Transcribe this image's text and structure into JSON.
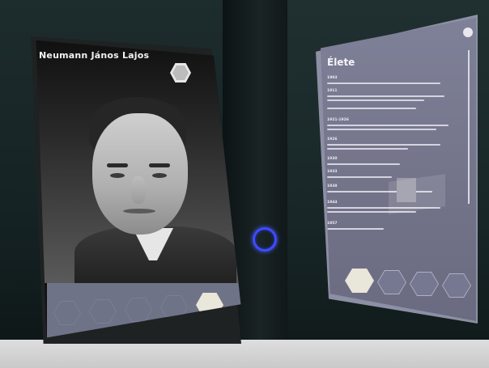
{
  "scene": {
    "description": "Museum exhibit with two vertical touchscreens and a blue ring sensor between them",
    "accent_ring_color": "#3c4cff"
  },
  "left_screen": {
    "person_name": "Neumann János Lajos",
    "logo_icon": "hex-seal-icon",
    "nav_hexagons": [
      {
        "label": "",
        "state": "outline"
      },
      {
        "label": "",
        "state": "outline"
      },
      {
        "label": "",
        "state": "outline"
      },
      {
        "label": "",
        "state": "outline"
      },
      {
        "label": "",
        "state": "active"
      }
    ]
  },
  "right_screen": {
    "title": "Élete",
    "entries": [
      {
        "year": "1903"
      },
      {
        "year": "1911"
      },
      {
        "year": "1921-1926"
      },
      {
        "year": "1926"
      },
      {
        "year": "1930"
      },
      {
        "year": "1933"
      },
      {
        "year": "1938"
      },
      {
        "year": "1944"
      },
      {
        "year": "1957"
      }
    ],
    "nav_hexagons": [
      {
        "icon": "hexagon-active-icon",
        "state": "active"
      },
      {
        "icon": "tree-icon",
        "state": "outline"
      },
      {
        "icon": "group-icon",
        "state": "outline"
      },
      {
        "icon": "map-icon",
        "state": "outline"
      }
    ]
  }
}
